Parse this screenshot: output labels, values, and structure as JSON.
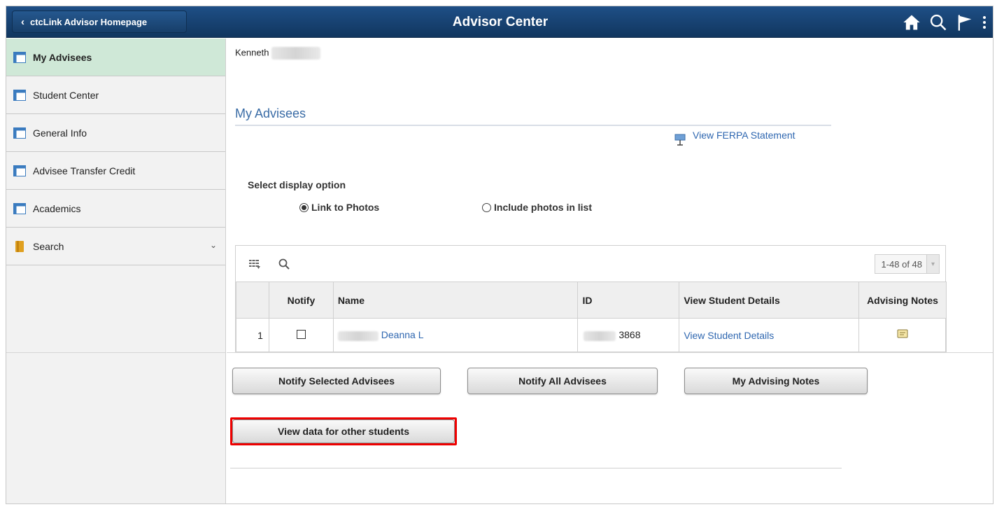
{
  "header": {
    "back_label": "ctcLink Advisor Homepage",
    "title": "Advisor Center",
    "icons": [
      "home-icon",
      "search-icon",
      "flag-icon",
      "more-vertical-icon"
    ]
  },
  "sidebar": {
    "items": [
      {
        "label": "My Advisees",
        "icon": "page-icon",
        "active": true
      },
      {
        "label": "Student Center",
        "icon": "page-icon"
      },
      {
        "label": "General Info",
        "icon": "page-icon"
      },
      {
        "label": "Advisee Transfer Credit",
        "icon": "page-icon"
      },
      {
        "label": "Academics",
        "icon": "page-icon"
      },
      {
        "label": "Search",
        "icon": "folder-icon",
        "expandable": true
      }
    ]
  },
  "main": {
    "user_first_name": "Kenneth",
    "section_title": "My Advisees",
    "ferpa_link": "View FERPA Statement",
    "display_option_label": "Select display option",
    "radio_options": [
      {
        "label": "Link to Photos",
        "selected": true
      },
      {
        "label": "Include photos in list",
        "selected": false
      }
    ],
    "grid": {
      "pager": "1-48 of 48",
      "columns": [
        "Notify",
        "Name",
        "ID",
        "View Student Details",
        "Advising Notes"
      ],
      "rows": [
        {
          "num": "1",
          "name": "Deanna L",
          "id": "3868",
          "details_link": "View Student Details"
        }
      ]
    },
    "buttons": {
      "notify_selected": "Notify Selected Advisees",
      "notify_all": "Notify All Advisees",
      "my_notes": "My Advising Notes",
      "view_other": "View data for other students"
    }
  },
  "colors": {
    "banner": "#173e69",
    "active_nav": "#cfe8d7",
    "link": "#2f67b0",
    "highlight": "#ee0000"
  }
}
